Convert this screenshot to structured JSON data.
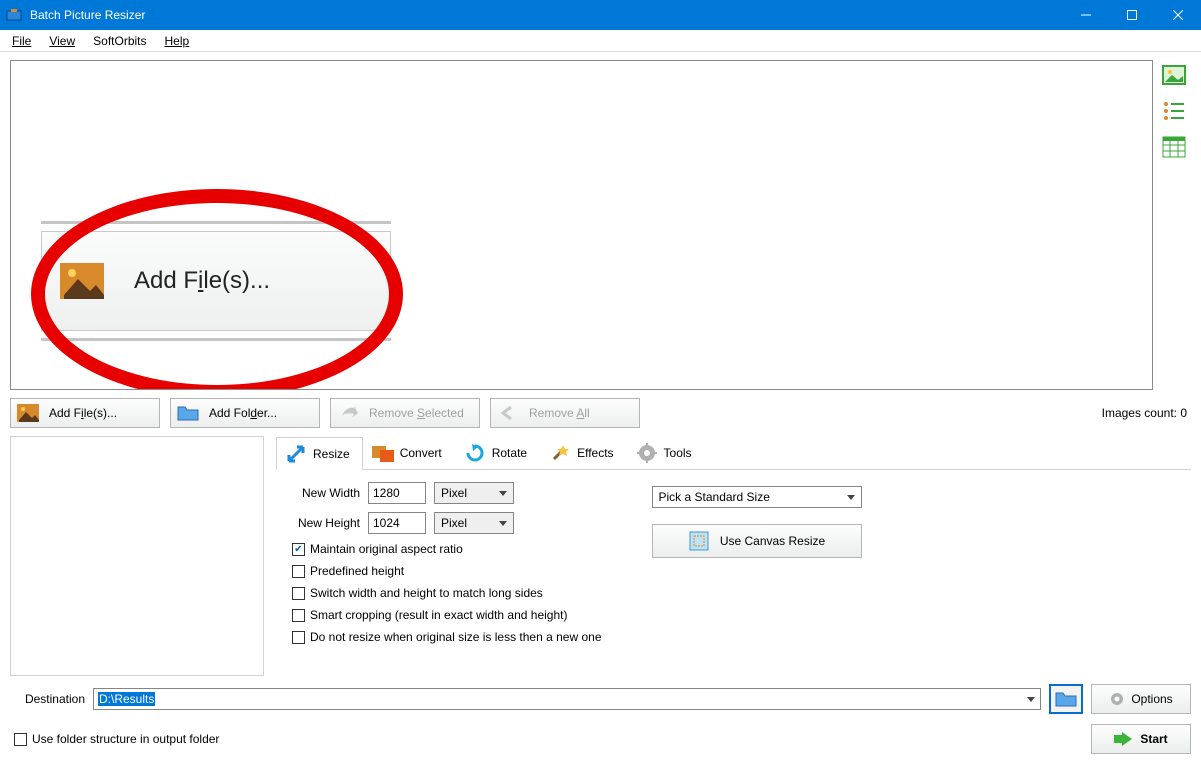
{
  "window": {
    "title": "Batch Picture Resizer"
  },
  "menu": {
    "file": "File",
    "view": "View",
    "softorbits": "SoftOrbits",
    "help": "Help"
  },
  "callout": {
    "label_pre": "Add F",
    "label_u": "i",
    "label_post": "le(s)..."
  },
  "toolbar": {
    "add_files_pre": "Add F",
    "add_files_u": "i",
    "add_files_post": "le(s)...",
    "add_folder_pre": "Add Fol",
    "add_folder_u": "d",
    "add_folder_post": "er...",
    "remove_sel_pre": "Remove ",
    "remove_sel_u": "S",
    "remove_sel_post": "elected",
    "remove_all_pre": "Remove ",
    "remove_all_u": "A",
    "remove_all_post": "ll",
    "count_label": "Images count: 0"
  },
  "tabs": {
    "resize": "Resize",
    "convert": "Convert",
    "rotate": "Rotate",
    "effects": "Effects",
    "tools": "Tools"
  },
  "resize": {
    "width_label": "New Width",
    "height_label": "New Height",
    "width_value": "1280",
    "height_value": "1024",
    "unit": "Pixel",
    "std_size": "Pick a Standard Size",
    "canvas_btn": "Use Canvas Resize",
    "chk_aspect": "Maintain original aspect ratio",
    "chk_predef": "Predefined height",
    "chk_switch": "Switch width and height to match long sides",
    "chk_smart": "Smart cropping (result in exact width and height)",
    "chk_noresize": "Do not resize when original size is less then a new one"
  },
  "dest": {
    "label": "Destination",
    "value": "D:\\Results"
  },
  "options_btn": "Options",
  "folder_struct": "Use folder structure in output folder",
  "start_btn": "Start"
}
